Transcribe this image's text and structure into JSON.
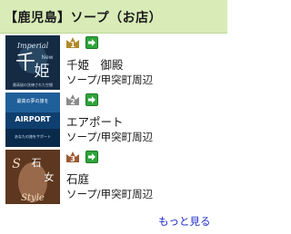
{
  "header": {
    "title": "【鹿児島】ソープ（お店）"
  },
  "ranking": [
    {
      "rank": "1",
      "rank_color": "#b08a2a",
      "name": "千姫　御殿",
      "area": "ソープ/甲突町周辺",
      "thumb_text": [
        "Imperial",
        "千",
        "姫",
        "New",
        "最高級の洗練された空間"
      ],
      "thumb_icon": "shop-banner-image"
    },
    {
      "rank": "2",
      "rank_color": "#8b8b8b",
      "name": "エアポート",
      "area": "ソープ/甲突町周辺",
      "thumb_text": [
        "最高の夢の旅を",
        "AIRPORT",
        "あなたの旅をサポート"
      ],
      "thumb_icon": "shop-banner-image"
    },
    {
      "rank": "3",
      "rank_color": "#9b5a33",
      "name": "石庭",
      "area": "ソープ/甲突町周辺",
      "thumb_text": [
        "S",
        "石",
        "女",
        "Style"
      ],
      "thumb_icon": "shop-banner-image"
    }
  ],
  "more_link": "もっと見る"
}
